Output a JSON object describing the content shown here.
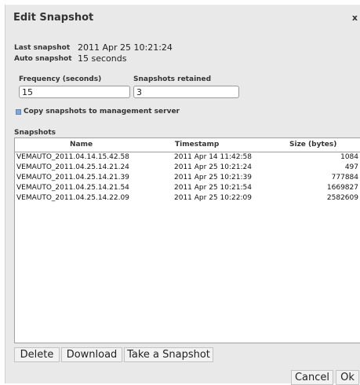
{
  "dialog": {
    "title": "Edit Snapshot",
    "close_label": "x"
  },
  "info": {
    "last_snapshot_label": "Last snapshot",
    "last_snapshot_value": "2011 Apr 25 10:21:24",
    "auto_snapshot_label": "Auto snapshot",
    "auto_snapshot_value": "15 seconds"
  },
  "form": {
    "frequency_label": "Frequency (seconds)",
    "frequency_value": "15",
    "retained_label": "Snapshots retained",
    "retained_value": "3",
    "copy_label": "Copy snapshots to management server"
  },
  "snapshots": {
    "section_label": "Snapshots",
    "columns": [
      "Name",
      "Timestamp",
      "Size (bytes)"
    ],
    "rows": [
      [
        "VEMAUTO_2011.04.14.15.42.58",
        "2011 Apr 14 11:42:58",
        "1084"
      ],
      [
        "VEMAUTO_2011.04.25.14.21.24",
        "2011 Apr 25 10:21:24",
        "497"
      ],
      [
        "VEMAUTO_2011.04.25.14.21.39",
        "2011 Apr 25 10:21:39",
        "777884"
      ],
      [
        "VEMAUTO_2011.04.25.14.21.54",
        "2011 Apr 25 10:21:54",
        "1669827"
      ],
      [
        "VEMAUTO_2011.04.25.14.22.09",
        "2011 Apr 25 10:22:09",
        "2582609"
      ]
    ]
  },
  "buttons": {
    "delete": "Delete",
    "download": "Download",
    "take_snapshot": "Take a Snapshot",
    "cancel": "Cancel",
    "ok": "Ok"
  }
}
